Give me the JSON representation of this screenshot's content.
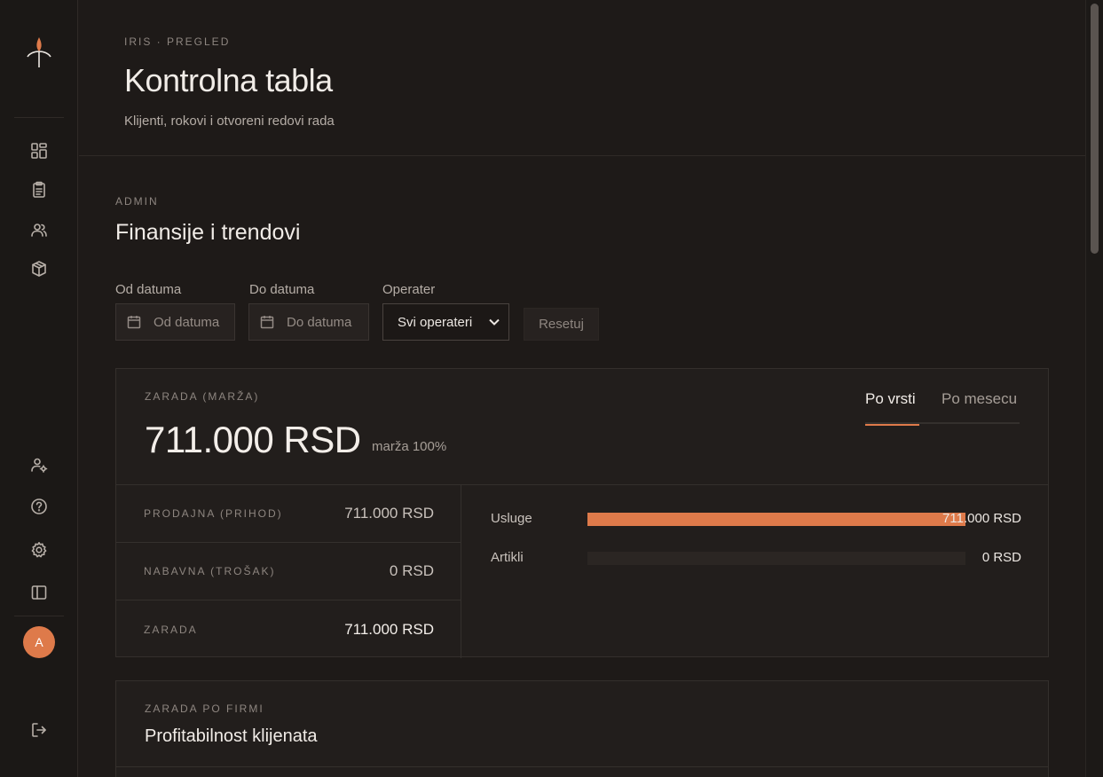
{
  "sidebar": {
    "nav_icons": [
      "dashboard-icon",
      "clipboard-icon",
      "users-icon",
      "package-icon"
    ],
    "bottom_icons": [
      "user-settings-icon",
      "help-icon",
      "gear-icon",
      "sidebar-toggle-icon"
    ],
    "avatar_initial": "A"
  },
  "header": {
    "eyebrow": "IRIS · PREGLED",
    "title": "Kontrolna tabla",
    "subtitle": "Klijenti, rokovi i otvoreni redovi rada"
  },
  "section": {
    "eyebrow": "ADMIN",
    "title": "Finansije i trendovi"
  },
  "filters": {
    "from_label": "Od datuma",
    "from_placeholder": "Od datuma",
    "to_label": "Do datuma",
    "to_placeholder": "Do datuma",
    "operator_label": "Operater",
    "operator_selected": "Svi operateri",
    "reset_label": "Resetuj"
  },
  "earnings_card": {
    "eyebrow": "ZARADA (MARŽA)",
    "value": "711.000 RSD",
    "margin_note": "marža 100%",
    "tabs": [
      {
        "label": "Po vrsti",
        "active": true
      },
      {
        "label": "Po mesecu",
        "active": false
      }
    ],
    "rows": [
      {
        "label": "PRODAJNA (PRIHOD)",
        "value": "711.000 RSD"
      },
      {
        "label": "NABAVNA (TROŠAK)",
        "value": "0 RSD"
      },
      {
        "label": "ZARADA",
        "value": "711.000 RSD"
      }
    ],
    "breakdown": [
      {
        "label": "Usluge",
        "value": "711.000 RSD",
        "fraction": 1.0
      },
      {
        "label": "Artikli",
        "value": "0 RSD",
        "fraction": 0.0
      }
    ],
    "accent_color": "#de7a4a"
  },
  "clients_card": {
    "eyebrow": "ZARADA PO FIRMI",
    "title": "Profitabilnost klijenata"
  }
}
